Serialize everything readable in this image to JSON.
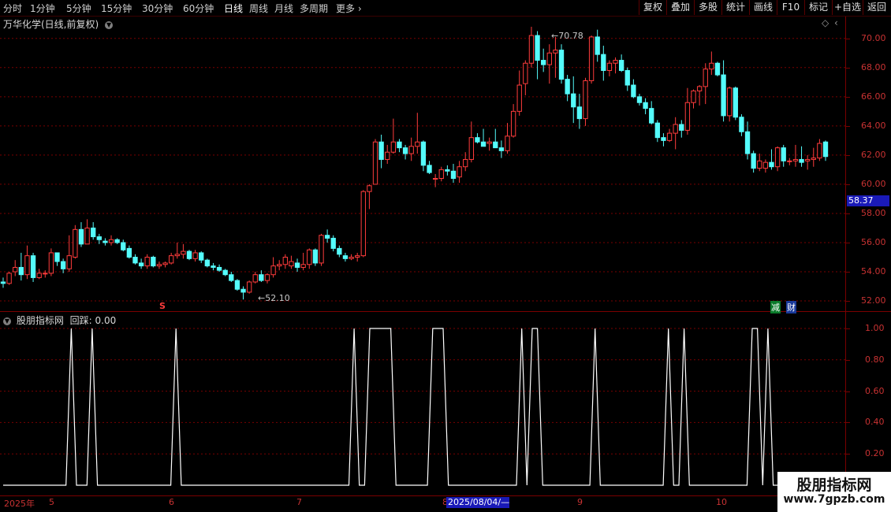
{
  "top_bar": {
    "periods": [
      "分时",
      "1分钟",
      "5分钟",
      "15分钟",
      "30分钟",
      "60分钟",
      "日线",
      "周线",
      "月线",
      "多周期",
      "更多"
    ],
    "active_period": "日线",
    "tools": [
      "复权",
      "叠加",
      "多股",
      "统计",
      "画线",
      "F10",
      "标记",
      "+自选",
      "返回"
    ]
  },
  "main_chart": {
    "title": "万华化学(日线,前复权)",
    "high_label": "70.78",
    "low_label": "52.10",
    "price_tag": "58.37",
    "marker_s": "S",
    "badge_reduce": "减",
    "badge_finance": "财",
    "y_ticks": [
      "70.00",
      "68.00",
      "66.00",
      "64.00",
      "62.00",
      "60.00",
      "58.00",
      "56.00",
      "54.00",
      "52.00"
    ]
  },
  "indicator": {
    "title": "股朋指标网",
    "value_text": "回踩: 0.00",
    "y_ticks": [
      "1.00",
      "0.80",
      "0.60",
      "0.40",
      "0.20"
    ]
  },
  "x_axis": {
    "labels": [
      "2025年",
      "5",
      "6",
      "7",
      "8",
      "9",
      "10"
    ],
    "cursor_date": "2025/08/04/—"
  },
  "watermark": {
    "line1": "股朋指标网",
    "line2": "www.7gpzb.com"
  },
  "colors": {
    "up": "#ff3c3c",
    "down": "#54fcfc",
    "grid": "#7a0000",
    "indicator": "#ffffff"
  },
  "chart_data": {
    "type": "candlestick",
    "ylim": [
      51.3,
      71.5
    ],
    "candles": [
      [
        53.3,
        53.6,
        52.9,
        53.2
      ],
      [
        53.2,
        54.0,
        53.1,
        53.9
      ],
      [
        54.0,
        54.8,
        53.7,
        54.3
      ],
      [
        54.3,
        55.3,
        53.4,
        53.8
      ],
      [
        53.8,
        55.8,
        53.5,
        55.1
      ],
      [
        55.1,
        55.3,
        53.3,
        53.6
      ],
      [
        53.6,
        54.2,
        53.5,
        53.9
      ],
      [
        53.9,
        54.1,
        53.6,
        53.9
      ],
      [
        53.9,
        55.6,
        53.7,
        55.3
      ],
      [
        55.3,
        55.3,
        54.4,
        54.7
      ],
      [
        54.7,
        54.9,
        53.9,
        54.2
      ],
      [
        54.2,
        56.5,
        54.0,
        55.1
      ],
      [
        55.0,
        57.2,
        54.9,
        56.9
      ],
      [
        56.9,
        57.4,
        55.7,
        55.9
      ],
      [
        55.9,
        57.6,
        55.9,
        57.0
      ],
      [
        57.0,
        57.4,
        56.2,
        56.4
      ],
      [
        56.4,
        56.6,
        55.9,
        56.2
      ],
      [
        56.1,
        56.3,
        55.8,
        56.0
      ],
      [
        56.0,
        56.5,
        55.8,
        56.2
      ],
      [
        56.2,
        56.3,
        55.9,
        56.0
      ],
      [
        56.0,
        56.2,
        55.4,
        55.5
      ],
      [
        55.6,
        55.8,
        54.9,
        55.0
      ],
      [
        55.0,
        55.2,
        54.5,
        54.6
      ],
      [
        54.6,
        54.9,
        54.2,
        54.4
      ],
      [
        54.4,
        55.2,
        54.2,
        55.0
      ],
      [
        55.0,
        55.1,
        54.3,
        54.4
      ],
      [
        54.4,
        54.7,
        54.2,
        54.5
      ],
      [
        54.5,
        54.7,
        54.3,
        54.6
      ],
      [
        54.6,
        55.3,
        54.5,
        55.1
      ],
      [
        55.1,
        56.0,
        54.9,
        55.2
      ],
      [
        55.2,
        55.9,
        54.9,
        55.4
      ],
      [
        55.4,
        55.5,
        54.8,
        54.9
      ],
      [
        54.9,
        55.5,
        54.7,
        55.3
      ],
      [
        55.3,
        55.4,
        54.6,
        54.8
      ],
      [
        54.8,
        54.9,
        54.3,
        54.4
      ],
      [
        54.4,
        54.6,
        54.1,
        54.3
      ],
      [
        54.3,
        54.5,
        54.0,
        54.1
      ],
      [
        54.1,
        54.2,
        53.7,
        53.8
      ],
      [
        53.8,
        54.0,
        53.3,
        53.4
      ],
      [
        53.4,
        53.5,
        52.7,
        52.8
      ],
      [
        52.8,
        53.0,
        52.1,
        52.6
      ],
      [
        52.6,
        53.4,
        52.5,
        53.3
      ],
      [
        53.3,
        54.0,
        53.2,
        53.8
      ],
      [
        53.8,
        54.1,
        53.3,
        53.4
      ],
      [
        53.4,
        53.9,
        53.2,
        53.8
      ],
      [
        53.8,
        55.0,
        53.6,
        54.4
      ],
      [
        54.4,
        54.8,
        54.1,
        54.5
      ],
      [
        54.5,
        55.2,
        54.2,
        55.0
      ],
      [
        54.4,
        55.1,
        54.2,
        54.7
      ],
      [
        54.6,
        54.9,
        54.0,
        54.3
      ],
      [
        54.3,
        55.3,
        54.1,
        54.5
      ],
      [
        54.5,
        55.6,
        54.2,
        55.5
      ],
      [
        55.5,
        55.6,
        54.4,
        54.6
      ],
      [
        54.6,
        56.6,
        54.4,
        56.5
      ],
      [
        56.5,
        56.9,
        56.0,
        56.3
      ],
      [
        56.3,
        56.5,
        55.4,
        55.6
      ],
      [
        55.6,
        55.8,
        55.0,
        55.2
      ],
      [
        55.1,
        55.3,
        54.7,
        54.9
      ],
      [
        54.9,
        55.2,
        54.8,
        55.0
      ],
      [
        55.0,
        55.3,
        54.7,
        55.1
      ],
      [
        55.1,
        59.6,
        55.0,
        59.5
      ],
      [
        59.5,
        60.0,
        58.3,
        59.9
      ],
      [
        60.0,
        63.1,
        60.2,
        62.9
      ],
      [
        62.9,
        63.4,
        61.1,
        61.7
      ],
      [
        61.7,
        62.7,
        61.4,
        62.2
      ],
      [
        62.2,
        64.5,
        62.1,
        62.9
      ],
      [
        62.9,
        63.1,
        62.2,
        62.5
      ],
      [
        62.5,
        62.7,
        61.7,
        62.1
      ],
      [
        62.1,
        63.2,
        61.6,
        62.6
      ],
      [
        62.6,
        64.9,
        62.1,
        62.9
      ],
      [
        62.9,
        63.0,
        60.9,
        61.3
      ],
      [
        61.3,
        61.6,
        60.7,
        60.8
      ],
      [
        60.4,
        60.7,
        59.8,
        60.4
      ],
      [
        60.4,
        61.2,
        60.2,
        61.0
      ],
      [
        61.0,
        61.3,
        60.6,
        60.9
      ],
      [
        60.9,
        61.4,
        60.1,
        60.4
      ],
      [
        60.5,
        61.6,
        60.1,
        61.2
      ],
      [
        61.2,
        62.2,
        60.9,
        61.7
      ],
      [
        61.7,
        64.3,
        61.5,
        63.2
      ],
      [
        63.2,
        63.5,
        62.8,
        62.9
      ],
      [
        62.9,
        63.8,
        62.6,
        62.6
      ],
      [
        62.8,
        63.2,
        62.3,
        62.9
      ],
      [
        62.9,
        63.8,
        62.5,
        62.5
      ],
      [
        62.5,
        63.0,
        61.8,
        62.3
      ],
      [
        62.3,
        64.2,
        62.1,
        63.3
      ],
      [
        63.3,
        65.5,
        63.2,
        65.0
      ],
      [
        65.0,
        67.8,
        64.7,
        66.8
      ],
      [
        66.9,
        68.5,
        66.1,
        68.3
      ],
      [
        68.3,
        70.8,
        68.0,
        70.2
      ],
      [
        70.2,
        70.5,
        67.2,
        68.5
      ],
      [
        68.5,
        69.3,
        67.7,
        68.2
      ],
      [
        68.2,
        69.6,
        66.9,
        69.0
      ],
      [
        69.0,
        70.1,
        67.3,
        69.2
      ],
      [
        69.2,
        69.6,
        66.9,
        67.2
      ],
      [
        67.2,
        67.5,
        65.7,
        66.2
      ],
      [
        66.2,
        67.4,
        64.2,
        65.3
      ],
      [
        65.3,
        66.2,
        63.8,
        64.5
      ],
      [
        64.5,
        67.3,
        64.0,
        67.1
      ],
      [
        67.1,
        70.2,
        66.9,
        70.1
      ],
      [
        70.1,
        70.6,
        68.4,
        68.9
      ],
      [
        68.9,
        69.5,
        67.1,
        67.8
      ],
      [
        67.8,
        68.5,
        67.4,
        68.3
      ],
      [
        68.3,
        68.7,
        67.6,
        68.5
      ],
      [
        68.5,
        68.9,
        67.7,
        67.8
      ],
      [
        67.8,
        68.0,
        66.4,
        66.8
      ],
      [
        66.8,
        67.2,
        65.9,
        66.0
      ],
      [
        66.0,
        66.2,
        65.4,
        65.6
      ],
      [
        65.6,
        65.9,
        64.8,
        65.2
      ],
      [
        65.2,
        65.7,
        64.1,
        64.2
      ],
      [
        64.2,
        64.4,
        62.9,
        63.2
      ],
      [
        63.2,
        63.5,
        62.6,
        63.0
      ],
      [
        63.0,
        63.8,
        62.9,
        63.5
      ],
      [
        63.5,
        64.6,
        62.4,
        64.1
      ],
      [
        64.1,
        64.4,
        63.2,
        63.7
      ],
      [
        63.7,
        66.6,
        63.4,
        65.6
      ],
      [
        65.6,
        66.5,
        65.2,
        66.4
      ],
      [
        66.4,
        66.8,
        65.4,
        66.7
      ],
      [
        66.7,
        68.3,
        65.5,
        67.9
      ],
      [
        67.9,
        69.1,
        67.5,
        68.3
      ],
      [
        68.3,
        68.4,
        67.4,
        67.5
      ],
      [
        67.5,
        68.5,
        64.3,
        64.7
      ],
      [
        64.7,
        66.7,
        64.3,
        66.6
      ],
      [
        66.6,
        66.7,
        64.4,
        64.6
      ],
      [
        64.6,
        64.8,
        63.3,
        63.6
      ],
      [
        63.6,
        64.3,
        61.7,
        62.1
      ],
      [
        62.1,
        62.3,
        60.8,
        61.1
      ],
      [
        61.1,
        62.1,
        60.9,
        61.6
      ],
      [
        61.1,
        61.7,
        60.8,
        61.5
      ],
      [
        61.5,
        62.4,
        61.0,
        61.2
      ],
      [
        61.2,
        62.6,
        60.9,
        62.5
      ],
      [
        62.5,
        62.7,
        61.2,
        61.6
      ],
      [
        61.6,
        61.8,
        61.3,
        61.6
      ],
      [
        61.6,
        62.7,
        61.2,
        61.7
      ],
      [
        61.7,
        62.6,
        61.2,
        61.5
      ],
      [
        61.6,
        62.0,
        61.0,
        61.7
      ],
      [
        61.7,
        62.5,
        61.2,
        61.8
      ],
      [
        61.8,
        63.1,
        61.6,
        62.8
      ],
      [
        62.9,
        63.0,
        61.6,
        61.9
      ]
    ],
    "indicator_values": [
      0,
      0,
      0,
      0,
      0,
      0,
      0,
      0,
      0,
      0,
      0,
      0,
      0,
      1,
      0,
      0,
      0,
      1,
      0,
      0,
      0,
      0,
      0,
      0,
      0,
      0,
      0,
      0,
      0,
      0,
      0,
      0,
      0,
      1,
      0,
      0,
      0,
      0,
      0,
      0,
      0,
      0,
      0,
      0,
      0,
      0,
      0,
      0,
      0,
      0,
      0,
      0,
      0,
      0,
      0,
      0,
      0,
      0,
      0,
      0,
      0,
      0,
      0,
      0,
      0,
      0,
      0,
      1,
      0,
      0,
      1,
      1,
      1,
      1,
      1,
      0,
      0,
      0,
      0,
      0,
      0,
      0,
      1,
      1,
      1,
      0,
      0,
      0,
      0,
      0,
      0,
      0,
      0,
      0,
      0,
      0,
      0,
      0,
      0,
      1,
      0,
      1,
      1,
      0,
      0,
      0,
      0,
      0,
      0,
      0,
      0,
      0,
      0,
      1,
      0,
      0,
      0,
      0,
      0,
      0,
      0,
      0,
      0,
      0,
      0,
      0,
      0,
      1,
      0,
      0,
      1,
      0,
      0,
      0,
      0,
      0,
      0,
      0,
      0,
      0,
      0,
      0,
      0,
      1,
      1,
      0,
      1,
      0,
      0,
      0,
      0,
      0,
      0,
      0,
      0,
      0,
      0,
      0
    ]
  }
}
